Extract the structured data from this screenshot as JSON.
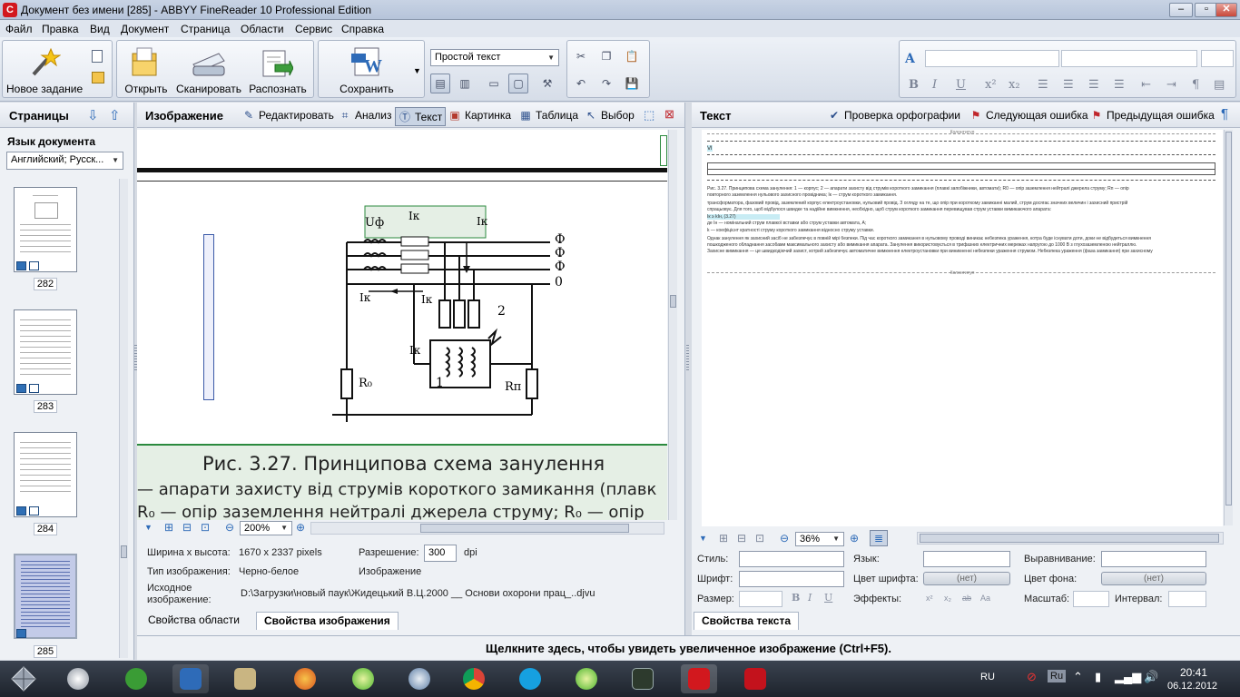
{
  "window": {
    "title": "Документ без имени [285] - ABBYY FineReader 10 Professional Edition",
    "logo_letter": "C"
  },
  "menu": [
    "Файл",
    "Правка",
    "Вид",
    "Документ",
    "Страница",
    "Области",
    "Сервис",
    "Справка"
  ],
  "toolbar": {
    "new_task": "Новое задание",
    "open": "Открыть",
    "scan": "Сканировать",
    "recognize": "Распознать",
    "save": "Сохранить",
    "format_select": "Простой текст"
  },
  "pages": {
    "title": "Страницы",
    "doc_lang_label": "Язык документа",
    "doc_lang_value": "Английский; Русск...",
    "thumbs": [
      "282",
      "283",
      "284",
      "285"
    ]
  },
  "image_panel": {
    "title": "Изображение",
    "tools": [
      "Редактировать",
      "Анализ",
      "Текст",
      "Картинка",
      "Таблица",
      "Выбор"
    ],
    "zoom": "200%",
    "caption_title": "Рис. 3.27. Принципова схема занулення",
    "caption_line2": "— апарати захисту від струмів короткого замикання (плавк",
    "caption_line3": "R₀ — опір заземлення нейтралі джерела струму; R₀ — опір",
    "diagram_labels": {
      "u": "Uф",
      "ik_top": "Iк",
      "ik_top2": "Iк",
      "ik_left": "Iк",
      "ik_mid": "Iк",
      "ik_low": "Iк",
      "phase": "Ф",
      "zero": "0",
      "one": "1",
      "two": "2",
      "r0": "R₀",
      "rn": "Rп"
    },
    "props": {
      "size_label": "Ширина x высота:",
      "size_value": "1670 x 2337 pixels",
      "res_label": "Разрешение:",
      "res_value": "300",
      "res_unit": "dpi",
      "type_label": "Тип изображения:",
      "type_value": "Черно-белое",
      "image_label": "Изображение",
      "source_label_1": "Исходное",
      "source_label_2": "изображение:",
      "source_value": "D:\\Загрузки\\новый паук\\Жидецький В.Ц.2000 __ Основи охорони прац_..djvu"
    },
    "tabs": [
      "Свойства области",
      "Свойства изображения"
    ]
  },
  "text_panel": {
    "title": "Текст",
    "spell_check": "Проверка орфографии",
    "next_error": "Следующая ошибка",
    "prev_error": "Предыдущая ошибка",
    "header_label": "Колонтитул",
    "footer_label": "Колонтитул",
    "zoom": "36%",
    "body_lines": [
      "Рис. 3.27. Принципова схема занулення: 1 — корпус; 2 — апарати захисту від струмів короткого замикання (плавкі запобіжники, автомати); R0 — опір заземлення нейтралі джерела струму; Rп — опір",
      "повторного заземлення нульового захисного провідника; Iк — струм короткого замикання.",
      "трансформатора, фазовий провід, заземлений корпус електроустановки, нульовий провід. З огляду на те, що опір при короткому замиканні малий, струм досягає значних величин і захисний пристрій",
      "спрацьовує. Для того, щоб відбулося швидке та надійне вимкнення, необхідно, щоб струм короткого замикання перевищував струм уставки вимикаючого апарата:",
      "Iк ≥ kIн,                  (3.27)",
      "де Iн — номінальний струм плавкої вставки або струм уставки автомата, А;",
      "k — коефіцієнт кратності струму короткого замикання відносно струму уставки.",
      "Однак занулення як захисний засіб не забезпечує в повній мірі безпеки. Під час короткого замикання в нульовому проводі виникає небезпека ураження, котра буде існувати доти, доки не відбудеться вимкнення",
      "пошкодженого обладнання засобами максимального захисту або вимикання апарата. Занулення використовується в трифазних електричних мережах напругою до 1000 В з глухозаземленою нейтраллю.",
      "Захисне вимикання — це швидкодіючий захист, котрий забезпечує автоматичне вимкнення електроустановки при виникненні небезпеки ураження струмом. Небезпека ураження (фаза замикання) при захисному"
    ],
    "props": {
      "style": "Стиль:",
      "lang": "Язык:",
      "align": "Выравнивание:",
      "font": "Шрифт:",
      "font_color": "Цвет шрифта:",
      "font_color_value": "(нет)",
      "bg_color": "Цвет фона:",
      "bg_color_value": "(нет)",
      "size": "Размер:",
      "effects": "Эффекты:",
      "scale": "Масштаб:",
      "interval": "Интервал:"
    },
    "tab": "Свойства текста"
  },
  "hint": "Щелкните здесь, чтобы увидеть увеличенное изображение (Ctrl+F5).",
  "taskbar": {
    "lang": "RU",
    "tray_lang": "Ru",
    "time": "20:41",
    "date": "06.12.2012"
  },
  "colors": {
    "accent": "#d2181e",
    "text_block_border": "#2b8a3e",
    "selection": "#3b5aa8"
  }
}
